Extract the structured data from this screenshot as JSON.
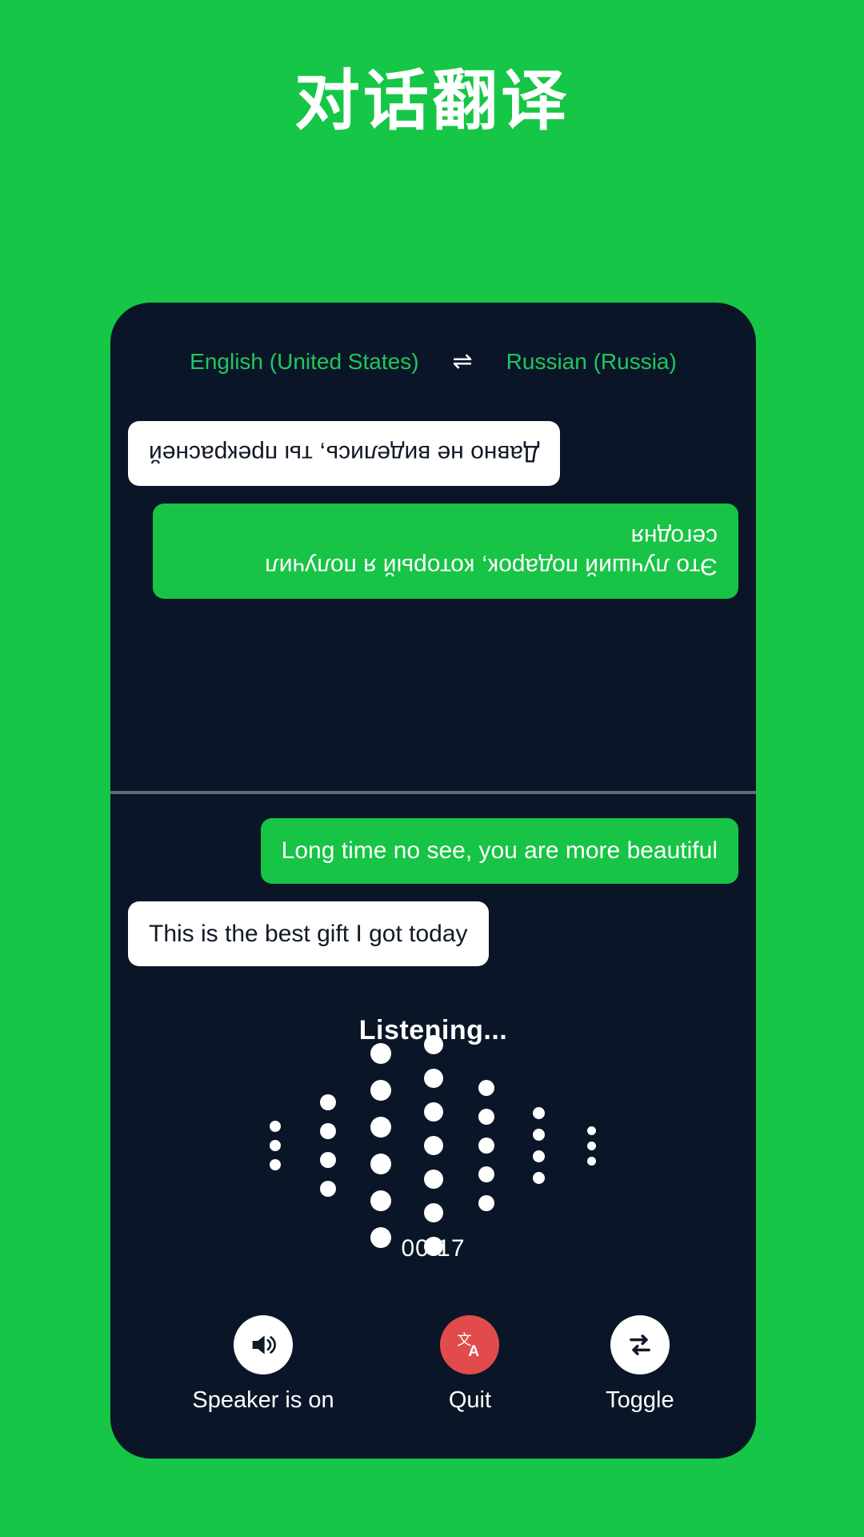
{
  "page": {
    "title": "对话翻译",
    "background_color": "#16c646"
  },
  "card": {
    "background_color": "#0a1628"
  },
  "language_bar": {
    "source_language": "English (United States)",
    "swap_icon": "swap-horizontal-icon",
    "swap_glyph": "⇌",
    "target_language": "Russian (Russia)",
    "text_color": "#22c55e"
  },
  "remote_pane": {
    "messages": [
      {
        "text": "Это лучший подарок, который я получил сегодня",
        "style": "green",
        "align": "left"
      },
      {
        "text": "Давно не виделись, ты прекрасней",
        "style": "white",
        "align": "right"
      }
    ]
  },
  "local_pane": {
    "messages": [
      {
        "text": "Long time no see, you are more beautiful",
        "style": "green",
        "align": "right"
      },
      {
        "text": "This is the best gift I got today",
        "style": "white",
        "align": "left"
      }
    ]
  },
  "listening": {
    "label": "Listening...",
    "timer": "00:17",
    "waveform": {
      "columns": [
        {
          "dots": 3,
          "size": 14
        },
        {
          "dots": 4,
          "size": 20
        },
        {
          "dots": 6,
          "size": 26
        },
        {
          "dots": 7,
          "size": 24
        },
        {
          "dots": 5,
          "size": 20
        },
        {
          "dots": 4,
          "size": 15
        },
        {
          "dots": 3,
          "size": 11
        }
      ],
      "dot_color": "#ffffff"
    }
  },
  "controls": [
    {
      "label": "Speaker is on",
      "icon": "speaker-on-icon",
      "circle_color": "#ffffff",
      "icon_color": "#111827"
    },
    {
      "label": "Quit",
      "icon": "translate-icon",
      "circle_color": "#e14b4b",
      "icon_color": "#ffffff"
    },
    {
      "label": "Toggle",
      "icon": "swap-arrows-icon",
      "circle_color": "#ffffff",
      "icon_color": "#111827"
    }
  ]
}
